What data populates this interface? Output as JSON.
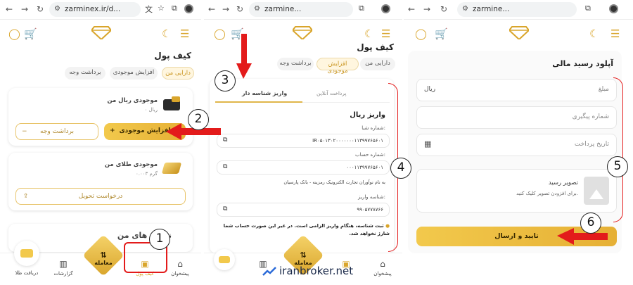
{
  "chrome": {
    "url_panel1": "zarminex.ir/d...",
    "url_panel2": "zarmine...",
    "url_panel3": "zarmine..."
  },
  "panel1": {
    "title": "کیف پول",
    "chips": [
      "دارایی من",
      "افزایش موجودی",
      "برداشت وجه"
    ],
    "rial_card": {
      "label": "موجودی ریال من",
      "value": "۰ ریال",
      "increase_btn": "افزایش موجودی",
      "increase_plus": "+",
      "withdraw_btn": "برداشت وجه",
      "withdraw_minus": "−"
    },
    "gold_card": {
      "label": "موجودی طلای من",
      "value": "۰.۰۰۳ گرم",
      "delivery_btn": "درخواست تحویل"
    },
    "section_peek": "نمو... های من",
    "bottom_nav": {
      "receive": "دریافت طلا",
      "reports": "گزارشات",
      "trade": "معامله",
      "wallet": "کیف پول",
      "dashboard": "پیشخوان"
    }
  },
  "panel2": {
    "title": "کیف پول",
    "chips": [
      "دارایی من",
      "افزایش موجودی",
      "برداشت وجه"
    ],
    "tabs": {
      "online": "پرداخت آنلاین",
      "deposit_id": "واریز شناسه دار"
    },
    "section_title": "واریز ریال",
    "sheba_label": "شماره شبا:",
    "sheba_value": "IR۰۵۰۱۳۰۲۰۰۰۰۰۰۰۱۱۳۹۹۷۶۵۶۰۱",
    "account_label": "شماره حساب:",
    "account_value": "۰۰۰۱۱۳۹۹۷۶۵۶۰۱",
    "owner_text": "به نام نوآوران تجارت الکترونیک رمزینه - بانک پارسیان",
    "deposit_id_label": "شناسه واریز:",
    "deposit_id_value": "۹۹۰۵۷۷۸۷۶۶",
    "warning": "ثبت شناسه، هنگام واریز الزامی است. در غیر این صورت حساب شما شارژ نخواهد شد.",
    "bottom_nav": {
      "trade": "معامله",
      "dashboard": "پیشخوان"
    }
  },
  "panel3": {
    "title": "آپلود رسید مالی",
    "amount_placeholder": "مبلغ",
    "amount_unit": "ریال",
    "tracking_placeholder": "شماره پیگیری",
    "date_placeholder": "تاریخ پرداخت",
    "upload_title": "تصویر رسید",
    "upload_hint": "برای افزودن تصویر کلیک کنید.",
    "submit_btn": "تایید و ارسال"
  },
  "annotations": {
    "n1": "1",
    "n2": "2",
    "n3": "3",
    "n4": "4",
    "n5": "5",
    "n6": "6"
  },
  "watermark": "iranbroker.net",
  "colors": {
    "gold": "#d9a52b",
    "annotation_red": "#e31b1b"
  }
}
